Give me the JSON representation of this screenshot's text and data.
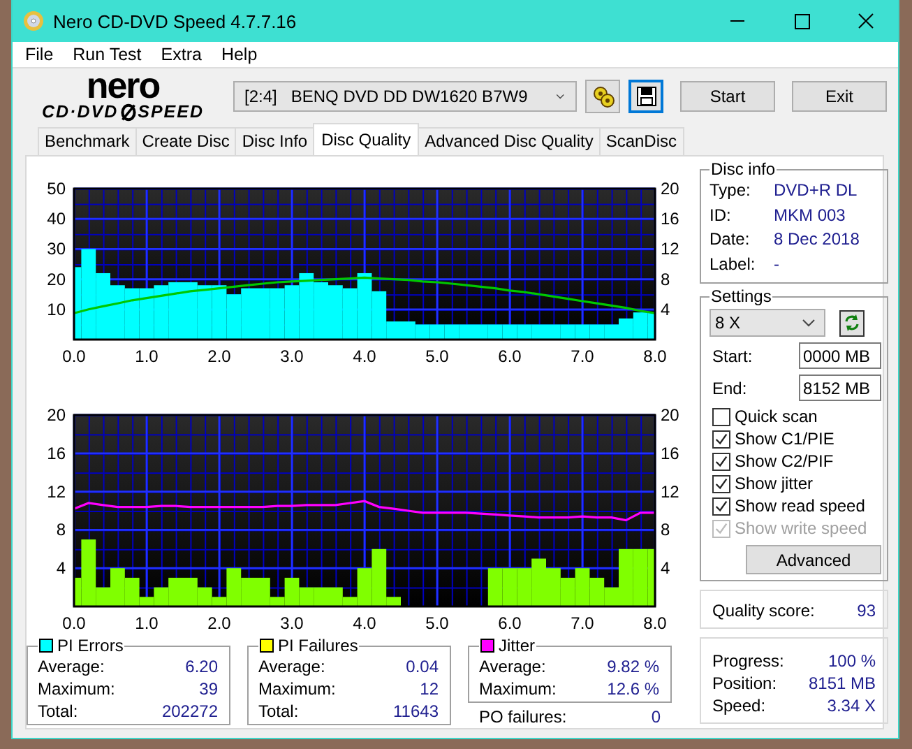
{
  "window": {
    "title": "Nero CD-DVD Speed 4.7.7.16"
  },
  "menu": [
    "File",
    "Run Test",
    "Extra",
    "Help"
  ],
  "logo": {
    "top": "nero",
    "bottom_left": "CD·DVD",
    "bottom_right": "SPEED"
  },
  "drive": {
    "port": "[2:4]",
    "name": "BENQ DVD DD DW1620 B7W9"
  },
  "buttons": [
    "Start",
    "Exit"
  ],
  "tabs": [
    {
      "label": "Benchmark",
      "selected": false
    },
    {
      "label": "Create Disc",
      "selected": false
    },
    {
      "label": "Disc Info",
      "selected": false
    },
    {
      "label": "Disc Quality",
      "selected": true
    },
    {
      "label": "Advanced Disc Quality",
      "selected": false
    },
    {
      "label": "ScanDisc",
      "selected": false
    }
  ],
  "charts": [
    {
      "chart_data": {
        "type": "bar",
        "x": [
          0,
          0.2,
          0.4,
          0.6,
          0.8,
          1,
          1.2,
          1.4,
          1.6,
          1.8,
          2,
          2.2,
          2.4,
          2.6,
          2.8,
          3,
          3.2,
          3.4,
          3.6,
          3.8,
          4,
          4.2,
          4.4,
          4.6,
          4.8,
          5,
          5.2,
          5.4,
          5.6,
          5.8,
          6,
          6.2,
          6.4,
          6.6,
          6.8,
          7,
          7.2,
          7.4,
          7.6,
          7.8,
          8
        ],
        "grid": true,
        "xlim": [
          0,
          8
        ],
        "ylim": [
          0,
          50
        ],
        "y2lim": [
          0,
          20
        ],
        "xticks": [
          {
            "value": 0,
            "label": "0.0"
          },
          {
            "value": 1,
            "label": "1.0"
          },
          {
            "value": 2,
            "label": "2.0"
          },
          {
            "value": 3,
            "label": "3.0"
          },
          {
            "value": 4,
            "label": "4.0"
          },
          {
            "value": 5,
            "label": "5.0"
          },
          {
            "value": 6,
            "label": "6.0"
          },
          {
            "value": 7,
            "label": "7.0"
          },
          {
            "value": 8,
            "label": "8.0"
          }
        ],
        "yticks": [
          10,
          20,
          30,
          40,
          50
        ],
        "y2ticks": [
          4,
          8,
          12,
          16,
          20
        ],
        "series": [
          {
            "color": "#00ffff",
            "type": "bar",
            "values": [
              24,
              30,
              22,
              18,
              17,
              17,
              18,
              19,
              19,
              18,
              18,
              15,
              17,
              17,
              17,
              18,
              22,
              19,
              18,
              17,
              22,
              16,
              6,
              6,
              5,
              5,
              5,
              5,
              5,
              5,
              5,
              5,
              5,
              5,
              5,
              5,
              5,
              5,
              7,
              9,
              9
            ]
          },
          {
            "color": "#00c800",
            "type": "line",
            "axis": "y2",
            "values": [
              3.5,
              4.0,
              4.4,
              4.8,
              5.2,
              5.5,
              5.8,
              6.1,
              6.4,
              6.6,
              6.8,
              7.0,
              7.2,
              7.4,
              7.6,
              7.7,
              7.8,
              7.9,
              8.0,
              8.1,
              8.2,
              8.1,
              8.0,
              7.9,
              7.7,
              7.6,
              7.4,
              7.2,
              7.0,
              6.8,
              6.5,
              6.3,
              6.0,
              5.7,
              5.4,
              5.1,
              4.8,
              4.5,
              4.2,
              3.8,
              3.5
            ]
          }
        ]
      }
    },
    {
      "chart_data": {
        "type": "bar",
        "x": [
          0,
          0.2,
          0.4,
          0.6,
          0.8,
          1,
          1.2,
          1.4,
          1.6,
          1.8,
          2,
          2.2,
          2.4,
          2.6,
          2.8,
          3,
          3.2,
          3.4,
          3.6,
          3.8,
          4,
          4.2,
          4.4,
          4.6,
          4.8,
          5,
          5.2,
          5.4,
          5.6,
          5.8,
          6,
          6.2,
          6.4,
          6.6,
          6.8,
          7,
          7.2,
          7.4,
          7.6,
          7.8,
          8
        ],
        "grid": true,
        "xlim": [
          0,
          8
        ],
        "ylim": [
          0,
          20
        ],
        "y2lim": [
          0,
          20
        ],
        "xticks": [
          {
            "value": 0,
            "label": "0.0"
          },
          {
            "value": 1,
            "label": "1.0"
          },
          {
            "value": 2,
            "label": "2.0"
          },
          {
            "value": 3,
            "label": "3.0"
          },
          {
            "value": 4,
            "label": "4.0"
          },
          {
            "value": 5,
            "label": "5.0"
          },
          {
            "value": 6,
            "label": "6.0"
          },
          {
            "value": 7,
            "label": "7.0"
          },
          {
            "value": 8,
            "label": "8.0"
          }
        ],
        "yticks": [
          4,
          8,
          12,
          16,
          20
        ],
        "y2ticks": [
          4,
          8,
          12,
          16,
          20
        ],
        "series": [
          {
            "color": "#80ff00",
            "type": "bar",
            "values": [
              3,
              7,
              2,
              4,
              3,
              1,
              2,
              3,
              3,
              2,
              1,
              4,
              3,
              3,
              1,
              3,
              2,
              2,
              2,
              1,
              4,
              6,
              1,
              0,
              0,
              0,
              0,
              0,
              0,
              4,
              4,
              4,
              5,
              4,
              3,
              4,
              3,
              2,
              6,
              6,
              6
            ]
          },
          {
            "color": "#ff00ff",
            "type": "line",
            "axis": "y2",
            "values": [
              10.2,
              10.8,
              10.6,
              10.4,
              10.4,
              10.4,
              10.5,
              10.5,
              10.4,
              10.4,
              10.4,
              10.4,
              10.4,
              10.4,
              10.5,
              10.5,
              10.6,
              10.6,
              10.6,
              10.8,
              11.0,
              10.4,
              10.2,
              10.0,
              9.8,
              9.8,
              9.8,
              9.8,
              9.7,
              9.6,
              9.5,
              9.4,
              9.3,
              9.3,
              9.3,
              9.4,
              9.3,
              9.3,
              9.0,
              9.8,
              9.8
            ]
          }
        ]
      }
    }
  ],
  "stats": [
    {
      "title": "PI Errors",
      "color": "#00ffff",
      "rows": [
        {
          "label": "Average:",
          "value": "6.20"
        },
        {
          "label": "Maximum:",
          "value": "39"
        },
        {
          "label": "Total:",
          "value": "202272"
        }
      ]
    },
    {
      "title": "PI Failures",
      "color": "#ffff00",
      "rows": [
        {
          "label": "Average:",
          "value": "0.04"
        },
        {
          "label": "Maximum:",
          "value": "12"
        },
        {
          "label": "Total:",
          "value": "11643"
        }
      ]
    },
    {
      "title": "Jitter",
      "color": "#ff00ff",
      "rows": [
        {
          "label": "Average:",
          "value": "9.82 %"
        },
        {
          "label": "Maximum:",
          "value": "12.6 %"
        }
      ]
    }
  ],
  "po_failures": {
    "label": "PO failures:",
    "value": "0"
  },
  "disc_info": {
    "title": "Disc info",
    "rows": [
      {
        "label": "Type:",
        "value": "DVD+R DL"
      },
      {
        "label": "ID:",
        "value": "MKM 003"
      },
      {
        "label": "Date:",
        "value": "8 Dec 2018"
      },
      {
        "label": "Label:",
        "value": "-"
      }
    ]
  },
  "settings": {
    "title": "Settings",
    "speed": "8 X",
    "start": {
      "label": "Start:",
      "value": "0000 MB"
    },
    "end": {
      "label": "End:",
      "value": "8152 MB"
    },
    "options": [
      {
        "label": "Quick scan",
        "checked": false,
        "disabled": false
      },
      {
        "label": "Show C1/PIE",
        "checked": true,
        "disabled": false
      },
      {
        "label": "Show C2/PIF",
        "checked": true,
        "disabled": false
      },
      {
        "label": "Show jitter",
        "checked": true,
        "disabled": false
      },
      {
        "label": "Show read speed",
        "checked": true,
        "disabled": false
      },
      {
        "label": "Show write speed",
        "checked": true,
        "disabled": true
      }
    ],
    "advanced": "Advanced"
  },
  "quality": {
    "label": "Quality score:",
    "value": "93"
  },
  "progress": [
    {
      "label": "Progress:",
      "value": "100 %"
    },
    {
      "label": "Position:",
      "value": "8151 MB"
    },
    {
      "label": "Speed:",
      "value": "3.34 X"
    }
  ]
}
